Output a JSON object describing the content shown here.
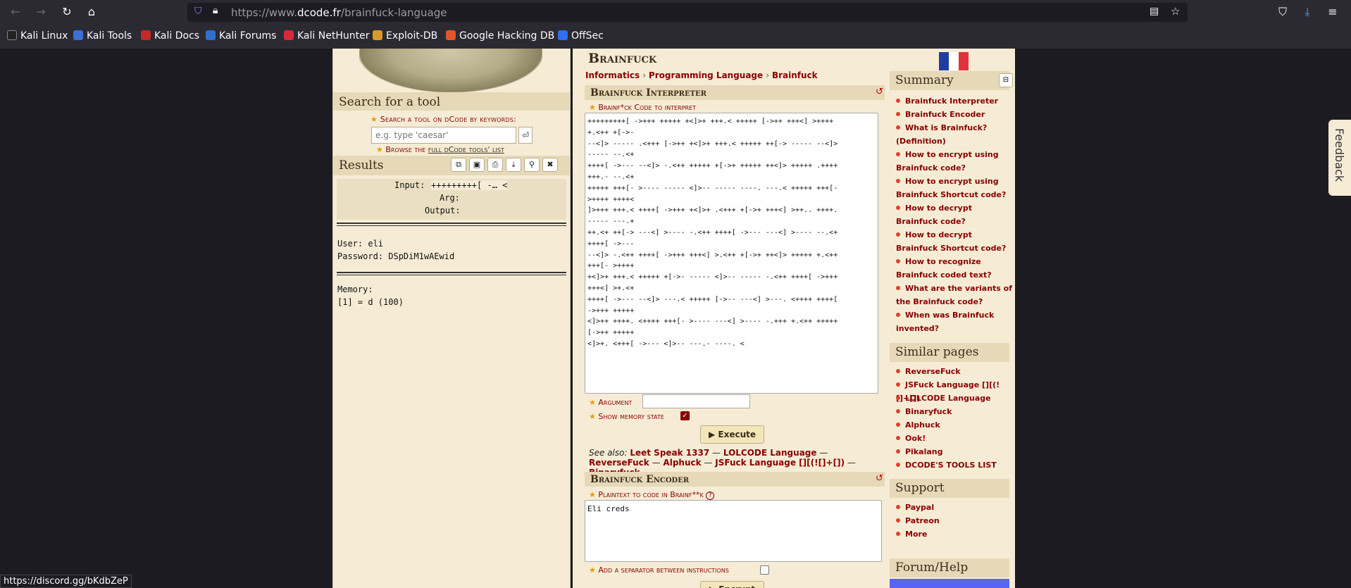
{
  "browser": {
    "url_prefix": "https://www.",
    "url_domain": "dcode.fr",
    "url_path": "/brainfuck-language",
    "bookmarks": [
      "Kali Linux",
      "Kali Tools",
      "Kali Docs",
      "Kali Forums",
      "Kali NetHunter",
      "Exploit-DB",
      "Google Hacking DB",
      "OffSec"
    ],
    "status_url": "https://discord.gg/bKdbZeP"
  },
  "left": {
    "search_title": "Search for a tool",
    "search_label": "Search a tool on dCode by keywords:",
    "search_placeholder": "e.g. type 'caesar'",
    "browse_prefix": "Browse the ",
    "browse_link": "full dCode tools' list",
    "results_title": "Results",
    "input_label": "Input:",
    "input_value": "+++++++++[ -… <",
    "arg_label": "Arg:",
    "output_label": "Output:",
    "output_line1": "User: eli",
    "output_line2": "Password: DSpDiM1wAEwid",
    "memory_label": "Memory:",
    "memory_value": "[1] = d (100)"
  },
  "main": {
    "title": "Brainfuck",
    "crumbs": [
      "Informatics",
      "Programming Language",
      "Brainfuck"
    ],
    "interp_title": "Brainfuck Interpreter",
    "code_label": "Brainf*ck Code to interpret",
    "code_lines": [
      "+++++++++[ ->+++ +++++ +<]>+ +++.< +++++ [->++ +++<] >++++",
      "+.<++ +[->-",
      "--<]> ----- .<+++ [->++ +<]>+ +++.< +++++ ++[-> ----- --<]>",
      "----- --.<+",
      "++++[ ->--- --<]> -.<++ +++++ +[->+ +++++ ++<]> +++++ .++++",
      "+++.- --.<+",
      "+++++ +++[- >---- ----- <]>-- ----- ----. ---.< +++++ +++[-",
      ">++++ ++++<",
      "]>+++ +++.< ++++[ ->+++ +<]>+ .<+++ +[->+ +++<] >++.. ++++.",
      "----- ---.+",
      "++.<+ ++[-> ---<] >---- -.<++ ++++[ ->--- ---<] >---- --.<+",
      "++++[ ->---",
      "--<]> -.<++ ++++[ ->+++ +++<] >.<++ +[->+ ++<]> +++++ +.<++",
      "+++[- >++++",
      "+<]>+ +++.< +++++ +[->- ----- <]>-- ----- -.<++ ++++[ ->+++",
      "+++<] >+.<+",
      "++++[ ->--- --<]> ---.< +++++ [->-- ---<] >---. <++++ ++++[",
      "->+++ +++++",
      "<]>++ ++++. <++++ +++[- >---- ---<] >---- -.+++ +.<++ +++++",
      "[->++ +++++",
      "<]>+. <+++[ ->--- <]>-- ---.- ----. <"
    ],
    "argument_label": "Argument",
    "memory_label": "Show memory state",
    "execute_label": "▶ Execute",
    "see_also_prefix": "See also: ",
    "see_also_links": [
      "Leet Speak 1337",
      "LOLCODE Language",
      "ReverseFuck",
      "Alphuck",
      "JSFuck Language [][(![]+[])",
      "Binaryfuck"
    ],
    "encoder_title": "Brainfuck Encoder",
    "plaintext_label": "Plaintext to code in Brainf**k",
    "plaintext_value": "Eli creds",
    "separator_label": "Add a separator between instructions",
    "encrypt_label": "▶ Encrypt"
  },
  "sidebar": {
    "summary_title": "Summary",
    "summary_links": [
      "Brainfuck Interpreter",
      "Brainfuck Encoder",
      "What is Brainfuck? (Definition)",
      "How to encrypt using Brainfuck code?",
      "How to encrypt using Brainfuck Shortcut code?",
      "How to decrypt Brainfuck code?",
      "How to decrypt Brainfuck Shortcut code?",
      "How to recognize Brainfuck coded text?",
      "What are the variants of the Brainfuck code?",
      "When was Brainfuck invented?"
    ],
    "similar_title": "Similar pages",
    "similar_links": [
      "ReverseFuck",
      "JSFuck Language [][(![]+[])",
      "LOLCODE Language",
      "Binaryfuck",
      "Alphuck",
      "Ook!",
      "Pikalang",
      "DCODE'S TOOLS LIST"
    ],
    "support_title": "Support",
    "support_links": [
      "Paypal",
      "Patreon",
      "More"
    ],
    "forum_title": "Forum/Help"
  },
  "feedback_label": "Feedback",
  "colors": {
    "accent": "#8b0000",
    "panel": "#f6ecd6",
    "header_bar": "#e6d9b8"
  }
}
